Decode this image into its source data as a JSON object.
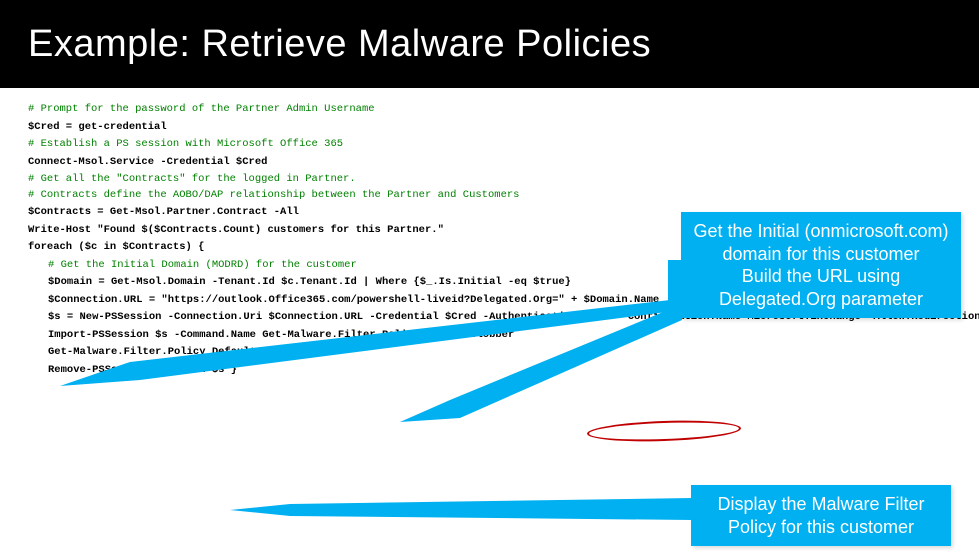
{
  "title": "Example: Retrieve Malware Policies",
  "code": {
    "c1": "# Prompt for the password of the Partner Admin Username",
    "l1": "$Cred = get-credential",
    "c2": "# Establish a PS session with Microsoft Office 365",
    "l2": "Connect-Msol.Service -Credential $Cred",
    "c3a": "# Get all the \"Contracts\" for the logged in Partner.",
    "c3b": "# Contracts define the AOBO/DAP relationship between the Partner and Customers",
    "l3": "$Contracts = Get-Msol.Partner.Contract -All",
    "l4": "Write-Host \"Found $($Contracts.Count) customers for this Partner.\"",
    "l5": "foreach ($c in $Contracts) {",
    "c4": "# Get the Initial Domain (MODRD) for the customer",
    "l6": "$Domain = Get-Msol.Domain -Tenant.Id $c.Tenant.Id | Where {$_.Is.Initial -eq $true}",
    "l7": "$Connection.URL = \"https://outlook.Office365.com/powershell-liveid?Delegated.Org=\" + $Domain.Name",
    "l8": "$s = New-PSSession -Connection.Uri $Connection.URL -Credential $Cred -Authentication Basic -Configuration.Name Microsoft.Exchange -Allow.Redirection",
    "l9": "Import-PSSession $s -Command.Name Get-Malware.Filter.Policy -Allow.Clobber",
    "l10": "Get-Malware.Filter.Policy Default",
    "l11": "Remove-PSSession -Session $s }"
  },
  "callouts": {
    "c1_line1": "Get the Initial (onmicrosoft.com)",
    "c1_line2": "domain for this customer",
    "c1_line3": "Build the URL using",
    "c1_line4": "Delegated.Org parameter",
    "c2_line1": "Display the Malware Filter",
    "c2_line2": "Policy for this customer"
  }
}
